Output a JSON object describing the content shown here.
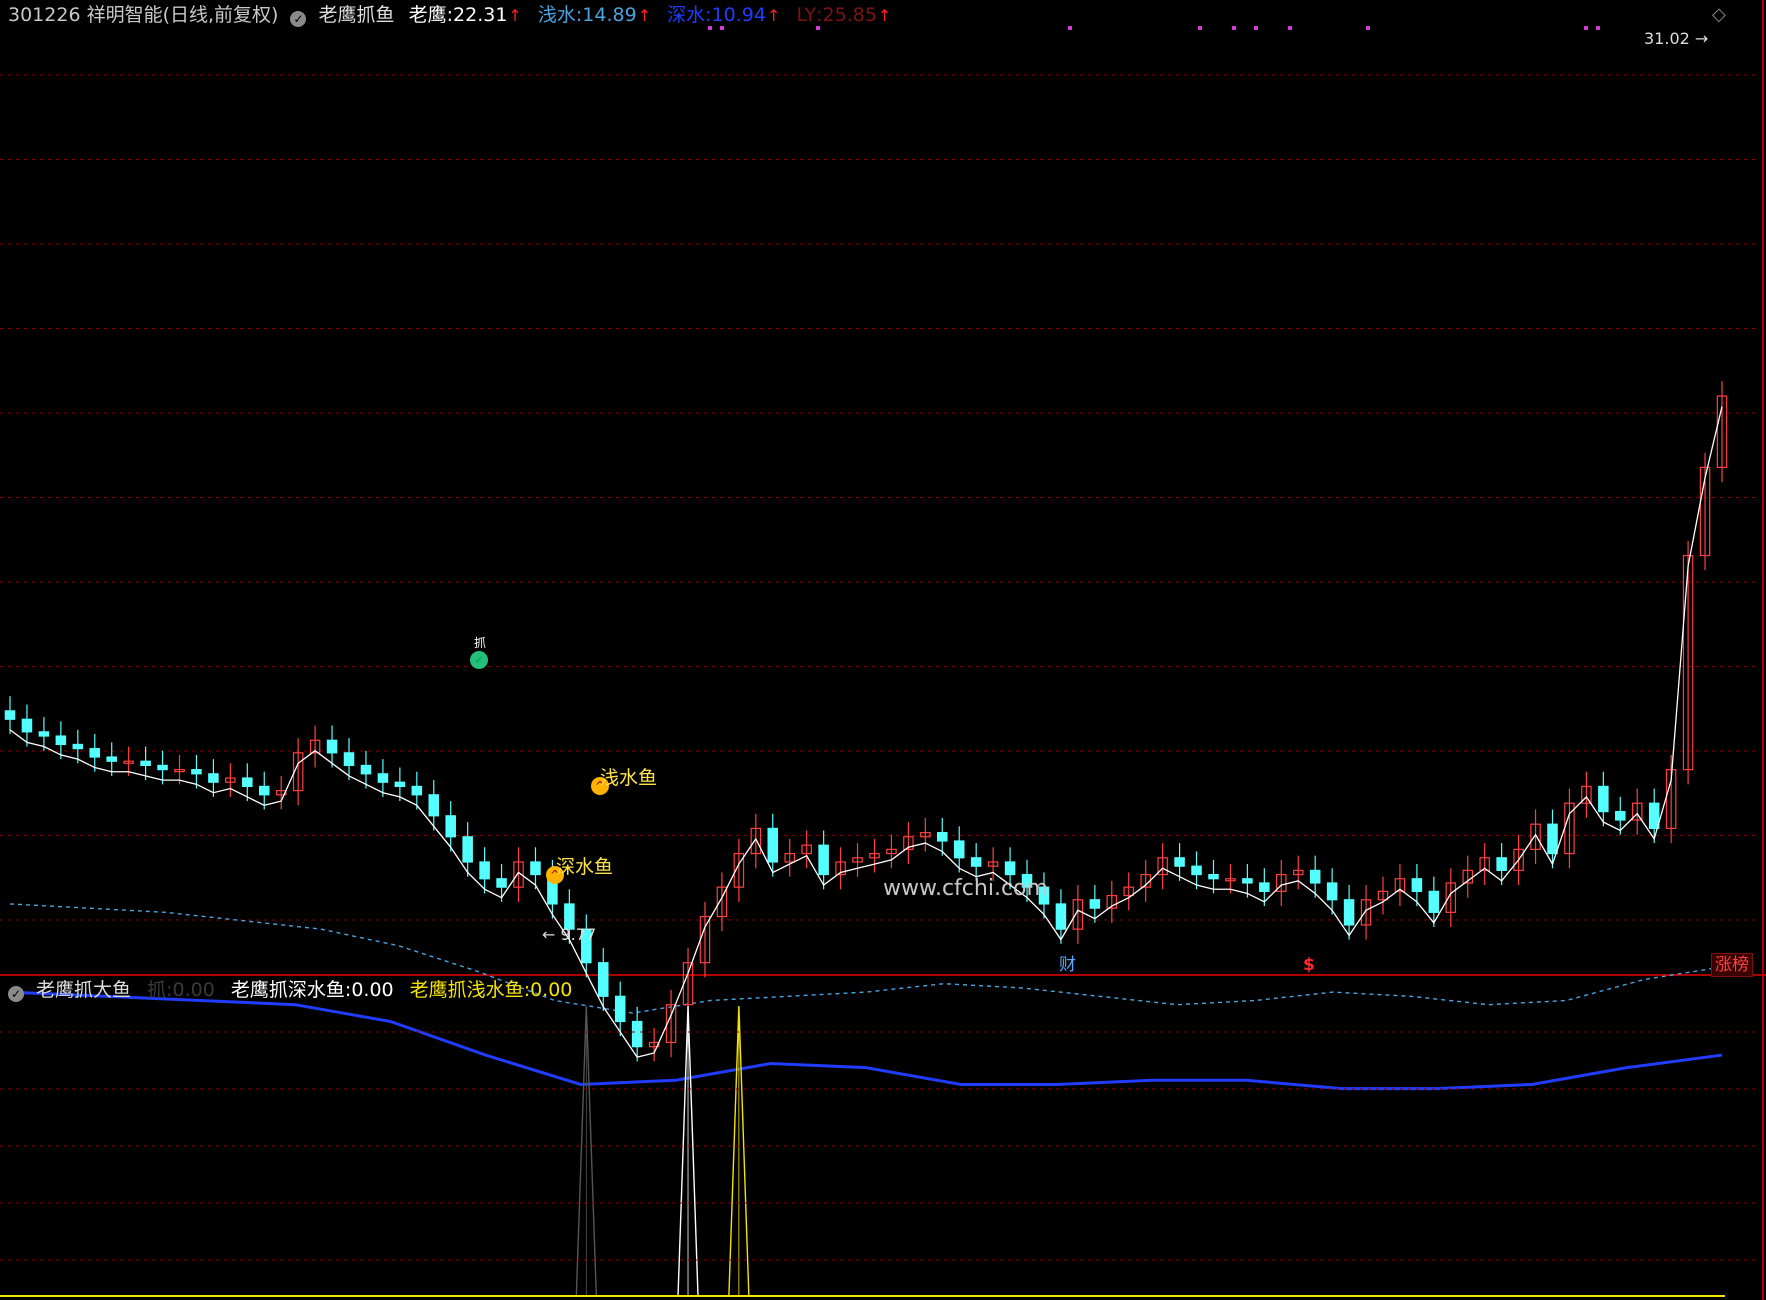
{
  "header": {
    "stock": "301226 祥明智能(日线,前复权)",
    "indicator_name": "老鹰抓鱼",
    "fields": [
      {
        "label": "老鹰",
        "value": "22.31",
        "color": "#ffffff"
      },
      {
        "label": "浅水",
        "value": "14.89",
        "color": "#4aa3df"
      },
      {
        "label": "深水",
        "value": "10.94",
        "color": "#1f3cff"
      },
      {
        "label": "LY",
        "value": "25.85",
        "color": "#7a1414"
      }
    ],
    "arrow": "↑"
  },
  "sub_header": {
    "name": "老鹰抓大鱼",
    "fields": [
      {
        "label": "抓",
        "value": "0.00",
        "color": "#3a3a3a"
      },
      {
        "label": "老鹰抓深水鱼",
        "value": "0.00",
        "color": "#ffffff"
      },
      {
        "label": "老鹰抓浅水鱼",
        "value": "0.00",
        "color": "#f5e400"
      }
    ]
  },
  "annotations": {
    "high": "31.02",
    "low": "9.77",
    "watermark": "www.cfchi.com",
    "deep_fish": "深水鱼",
    "shallow_fish": "浅水鱼",
    "catch_marker": "抓"
  },
  "badges": {
    "cai": "财",
    "dollar": "$",
    "zhangbang": "涨榜"
  },
  "colors": {
    "up": "#ff4040",
    "down": "#54ffff",
    "shallow": "#4aa3df",
    "deep": "#1f3cff",
    "grid": "#8a0000",
    "eagle": "#ffffff"
  },
  "chart_data": {
    "type": "candlestick",
    "price_range": [
      9.77,
      31.02
    ],
    "close_approx": [
      14.6,
      14.3,
      14.2,
      14.0,
      13.9,
      13.7,
      13.6,
      13.6,
      13.5,
      13.4,
      13.4,
      13.3,
      13.1,
      13.2,
      13.0,
      12.8,
      12.9,
      13.8,
      14.1,
      13.8,
      13.5,
      13.3,
      13.1,
      13.0,
      12.8,
      12.3,
      11.8,
      11.2,
      10.8,
      10.6,
      11.2,
      10.9,
      10.2,
      9.6,
      8.8,
      8.0,
      7.4,
      6.8,
      6.9,
      7.8,
      8.8,
      9.9,
      10.6,
      11.4,
      12.0,
      11.2,
      11.4,
      11.6,
      10.9,
      11.2,
      11.3,
      11.4,
      11.5,
      11.8,
      11.9,
      11.7,
      11.3,
      11.1,
      11.2,
      10.9,
      10.6,
      10.2,
      9.6,
      10.3,
      10.1,
      10.4,
      10.6,
      10.9,
      11.3,
      11.1,
      10.9,
      10.8,
      10.8,
      10.7,
      10.5,
      10.9,
      11.0,
      10.7,
      10.3,
      9.7,
      10.3,
      10.5,
      10.8,
      10.5,
      10.0,
      10.7,
      11.0,
      11.3,
      11.0,
      11.5,
      12.1,
      11.4,
      12.6,
      13.0,
      12.4,
      12.2,
      12.6,
      12.0,
      13.4,
      18.5,
      20.6,
      22.3
    ],
    "shallow_series": [
      10.2,
      10.1,
      10.0,
      9.8,
      9.6,
      9.2,
      8.6,
      7.9,
      7.6,
      7.9,
      8.0,
      8.1,
      8.3,
      8.2,
      8.0,
      7.8,
      7.9,
      8.1,
      8.0,
      7.8,
      7.9,
      8.4,
      8.7
    ],
    "deep_series": [
      8.1,
      8.0,
      7.9,
      7.8,
      7.4,
      6.6,
      5.9,
      6.0,
      6.4,
      6.3,
      5.9,
      5.9,
      6.0,
      6.0,
      5.8,
      5.8,
      5.9,
      6.3,
      6.6
    ],
    "signals": [
      {
        "name": "抓",
        "bar": 34
      },
      {
        "name": "深水鱼",
        "bar": 40
      },
      {
        "name": "浅水鱼",
        "bar": 43
      }
    ]
  }
}
